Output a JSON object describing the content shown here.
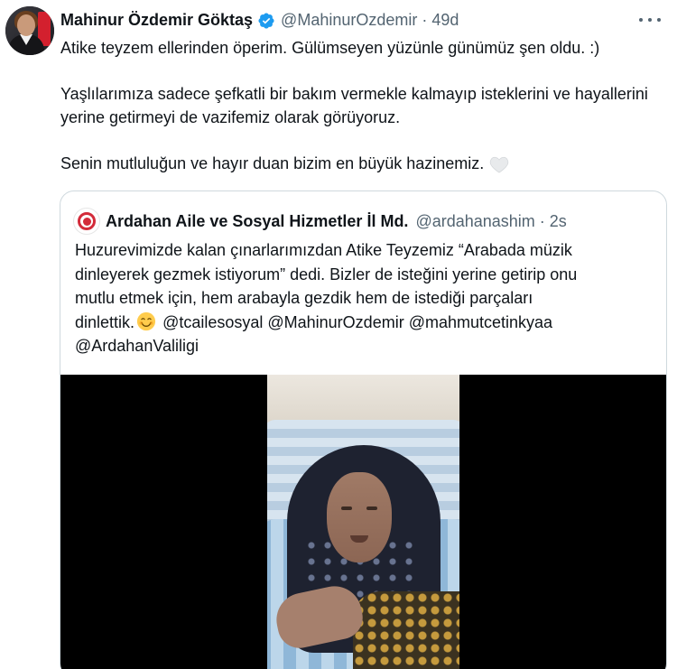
{
  "tweet": {
    "author_name": "Mahinur Özdemir Göktaş",
    "author_handle": "@MahinurOzdemir",
    "separator": "·",
    "time": "49d",
    "text_p1": "Atike teyzem ellerinden öperim. Gülümseyen yüzünle günümüz şen oldu. :)",
    "text_p2": "Yaşlılarımıza sadece şefkatli bir bakım vermekle kalmayıp isteklerini ve hayallerini yerine getirmeyi de vazifemiz olarak görüyoruz.",
    "text_p3": "Senin mutluluğun ve hayır duan bizim en büyük hazinemiz.",
    "verified_icon": "verified-badge-icon",
    "more_icon": "more-options-icon",
    "heart_icon": "white-heart-emoji"
  },
  "quoted": {
    "author_name": "Ardahan Aile ve Sosyal Hizmetler İl Md.",
    "author_handle": "@ardahanashim",
    "separator": "·",
    "time": "2s",
    "line1": "Huzurevimizde kalan çınarlarımızdan Atike Teyzemiz “Arabada müzik",
    "line2": "dinleyerek gezmek istiyorum” dedi. Bizler de isteğini yerine getirip onu",
    "line3": "mutlu etmek için, hem arabayla gezdik hem de istediği parçaları",
    "line4_a": "dinlettik.",
    "line4_b": "@tcailesosyal @MahinurOzdemir @mahmutcetinkyaa",
    "line5": "@ArdahanValiligi",
    "smiley_icon": "smiling-face-emoji"
  },
  "colors": {
    "text": "#0f1419",
    "muted": "#536471",
    "border": "#cfd9de",
    "verified": "#1d9bf0"
  }
}
